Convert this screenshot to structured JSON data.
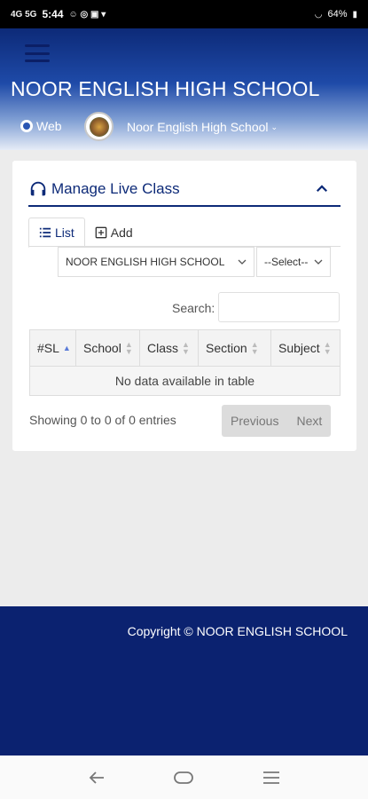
{
  "status_bar": {
    "left_text": "4G 5G",
    "time": "5:44",
    "battery": "64%"
  },
  "header": {
    "title": "NOOR ENGLISH HIGH SCHOOL",
    "web_label": "Web",
    "school_select_value": "Noor English High School"
  },
  "panel": {
    "title": "Manage Live Class",
    "tabs": [
      {
        "label": "List",
        "active": true
      },
      {
        "label": "Add",
        "active": false
      }
    ],
    "filters": {
      "school_value": "NOOR ENGLISH HIGH SCHOOL",
      "other_value": "--Select--"
    },
    "search_label": "Search:",
    "search_value": "",
    "table": {
      "columns": [
        "#SL",
        "School",
        "Class",
        "Section",
        "Subject"
      ],
      "empty_message": "No data available in table"
    },
    "info": "Showing 0 to 0 of 0 entries",
    "pagination": {
      "previous": "Previous",
      "next": "Next"
    }
  },
  "footer": {
    "copyright": "Copyright © NOOR ENGLISH SCHOOL"
  },
  "colors": {
    "primary": "#0d2a78",
    "footer_bg": "#0b2270",
    "page_bg": "#ececec"
  }
}
